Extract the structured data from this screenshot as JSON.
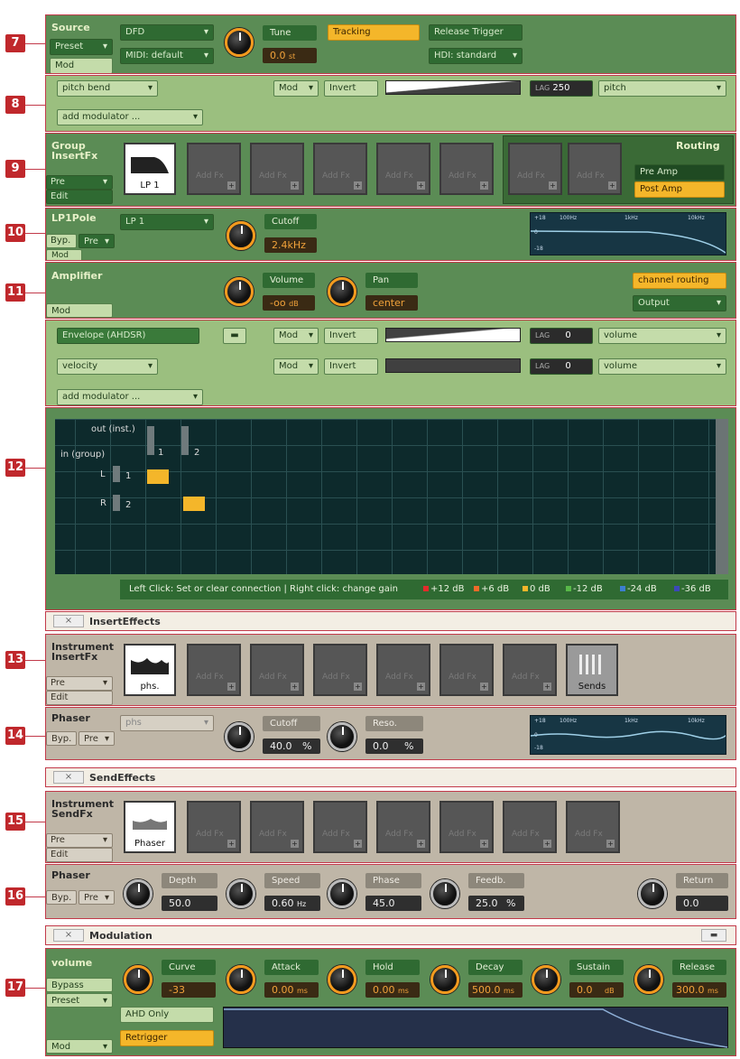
{
  "markers": [
    "7",
    "8",
    "9",
    "10",
    "11",
    "12",
    "13",
    "14",
    "15",
    "16",
    "17"
  ],
  "source": {
    "title": "Source",
    "dfd": "DFD",
    "midi": "MIDI: default",
    "tune_label": "Tune",
    "tune_value": "0.0",
    "tune_unit": "st",
    "tracking": "Tracking",
    "release": "Release Trigger",
    "hdi": "HDI: standard",
    "preset": "Preset",
    "mod": "Mod"
  },
  "row8": {
    "pitchbend": "pitch bend",
    "mod": "Mod",
    "invert": "Invert",
    "lag_label": "LAG",
    "lag_value": "250",
    "target": "pitch",
    "add": "add modulator ..."
  },
  "group_fx": {
    "title": "Group InsertFx",
    "pre": "Pre",
    "edit": "Edit",
    "lp1": "LP 1",
    "addfx": "Add Fx",
    "routing": "Routing",
    "pre_amp": "Pre Amp",
    "post_amp": "Post Amp"
  },
  "lp1pole": {
    "title": "LP1Pole",
    "byp": "Byp.",
    "pre": "Pre",
    "mod": "Mod",
    "type": "LP 1",
    "cutoff_label": "Cutoff",
    "cutoff_value": "2.4kHz",
    "spec": [
      "+18",
      "100Hz",
      "1kHz",
      "10kHz",
      "0",
      "-18"
    ]
  },
  "amp": {
    "title": "Amplifier",
    "volume_label": "Volume",
    "volume_value": "-oo",
    "volume_unit": "dB",
    "pan_label": "Pan",
    "pan_value": "center",
    "channel_routing": "channel routing",
    "output": "Output",
    "mod": "Mod"
  },
  "env": {
    "envelope": "Envelope (AHDSR)",
    "mod": "Mod",
    "invert": "Invert",
    "lag_label": "LAG",
    "lag1": "0",
    "target1": "volume",
    "velocity": "velocity",
    "lag2": "0",
    "target2": "volume",
    "add": "add modulator ...",
    "out": "out (inst.)",
    "in": "in (group)",
    "col1": "1",
    "col2": "2",
    "rowL": "L",
    "row1": "1",
    "rowR": "R",
    "row2": "2",
    "legend_text": "Left Click: Set or clear connection | Right click: change gain",
    "legend": [
      {
        "t": "+12 dB",
        "c": "#e32b2b"
      },
      {
        "t": "+6 dB",
        "c": "#ef6a2a"
      },
      {
        "t": "0 dB",
        "c": "#f4b62a"
      },
      {
        "t": "-12 dB",
        "c": "#58b848"
      },
      {
        "t": "-24 dB",
        "c": "#3c7fd0"
      },
      {
        "t": "-36 dB",
        "c": "#3c48b8"
      }
    ]
  },
  "insert_tab": {
    "close": "×",
    "title": "InsertEffects"
  },
  "inst_fx": {
    "title": "Instrument InsertFx",
    "pre": "Pre",
    "edit": "Edit",
    "phs": "phs.",
    "addfx": "Add Fx",
    "sends": "Sends"
  },
  "phaser1": {
    "title": "Phaser",
    "byp": "Byp.",
    "pre": "Pre",
    "type": "phs",
    "cutoff_label": "Cutoff",
    "cutoff_value": "40.0",
    "cutoff_unit": "%",
    "reso_label": "Reso.",
    "reso_value": "0.0",
    "reso_unit": "%",
    "spec": [
      "+18",
      "100Hz",
      "1kHz",
      "10kHz",
      "0",
      "-18"
    ]
  },
  "send_tab": {
    "close": "×",
    "title": "SendEffects"
  },
  "send_fx": {
    "title": "Instrument SendFx",
    "pre": "Pre",
    "edit": "Edit",
    "phaser": "Phaser",
    "addfx": "Add Fx"
  },
  "phaser2": {
    "title": "Phaser",
    "byp": "Byp.",
    "pre": "Pre",
    "depth_label": "Depth",
    "depth_value": "50.0",
    "speed_label": "Speed",
    "speed_value": "0.60",
    "speed_unit": "Hz",
    "phase_label": "Phase",
    "phase_value": "45.0",
    "feedb_label": "Feedb.",
    "feedb_value": "25.0",
    "feedb_unit": "%",
    "return_label": "Return",
    "return_value": "0.0"
  },
  "mod_tab": {
    "close": "×",
    "title": "Modulation"
  },
  "volume_env": {
    "title": "volume",
    "bypass": "Bypass",
    "preset": "Preset",
    "mod": "Mod",
    "curve_label": "Curve",
    "curve_value": "-33",
    "attack_label": "Attack",
    "attack_value": "0.00",
    "hold_label": "Hold",
    "hold_value": "0.00",
    "decay_label": "Decay",
    "decay_value": "500.0",
    "sustain_label": "Sustain",
    "sustain_value": "0.0",
    "sustain_unit": "dB",
    "release_label": "Release",
    "release_value": "300.0",
    "ms": "ms",
    "ahd": "AHD Only",
    "retrigger": "Retrigger"
  }
}
